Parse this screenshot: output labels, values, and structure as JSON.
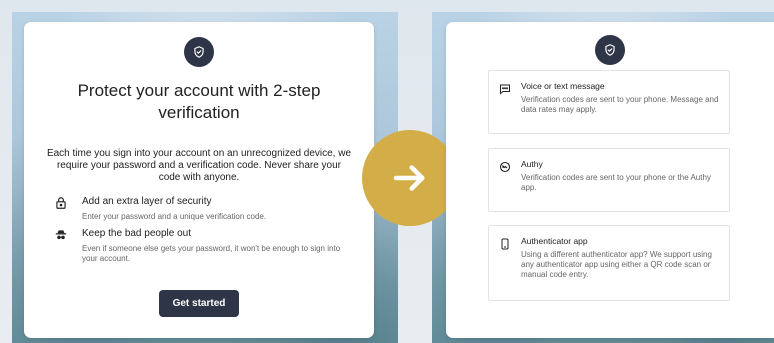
{
  "left_card": {
    "title": "Protect your account with 2-step verification",
    "intro": "Each time you sign into your account on an unrecognized device, we require your password and a verification code. Never share your code with anyone.",
    "features": [
      {
        "icon": "lock-icon",
        "heading": "Add an extra layer of security",
        "description": "Enter your password and a unique verification code."
      },
      {
        "icon": "spy-icon",
        "heading": "Keep the bad people out",
        "description": "Even if someone else gets your password, it won't be enough to sign into your account."
      }
    ],
    "button_label": "Get started"
  },
  "right_card": {
    "options": [
      {
        "icon": "message-icon",
        "heading": "Voice or text message",
        "description": "Verification codes are sent to your phone. Message and data rates may apply."
      },
      {
        "icon": "authy-icon",
        "heading": "Authy",
        "description": "Verification codes are sent to your phone or the Authy app."
      },
      {
        "icon": "phone-icon",
        "heading": "Authenticator app",
        "description": "Using a different authenticator app? We support using any authenticator app using either a QR code scan or manual code entry."
      }
    ]
  },
  "colors": {
    "primary": "#2e3546",
    "accent": "#d2ad48"
  }
}
